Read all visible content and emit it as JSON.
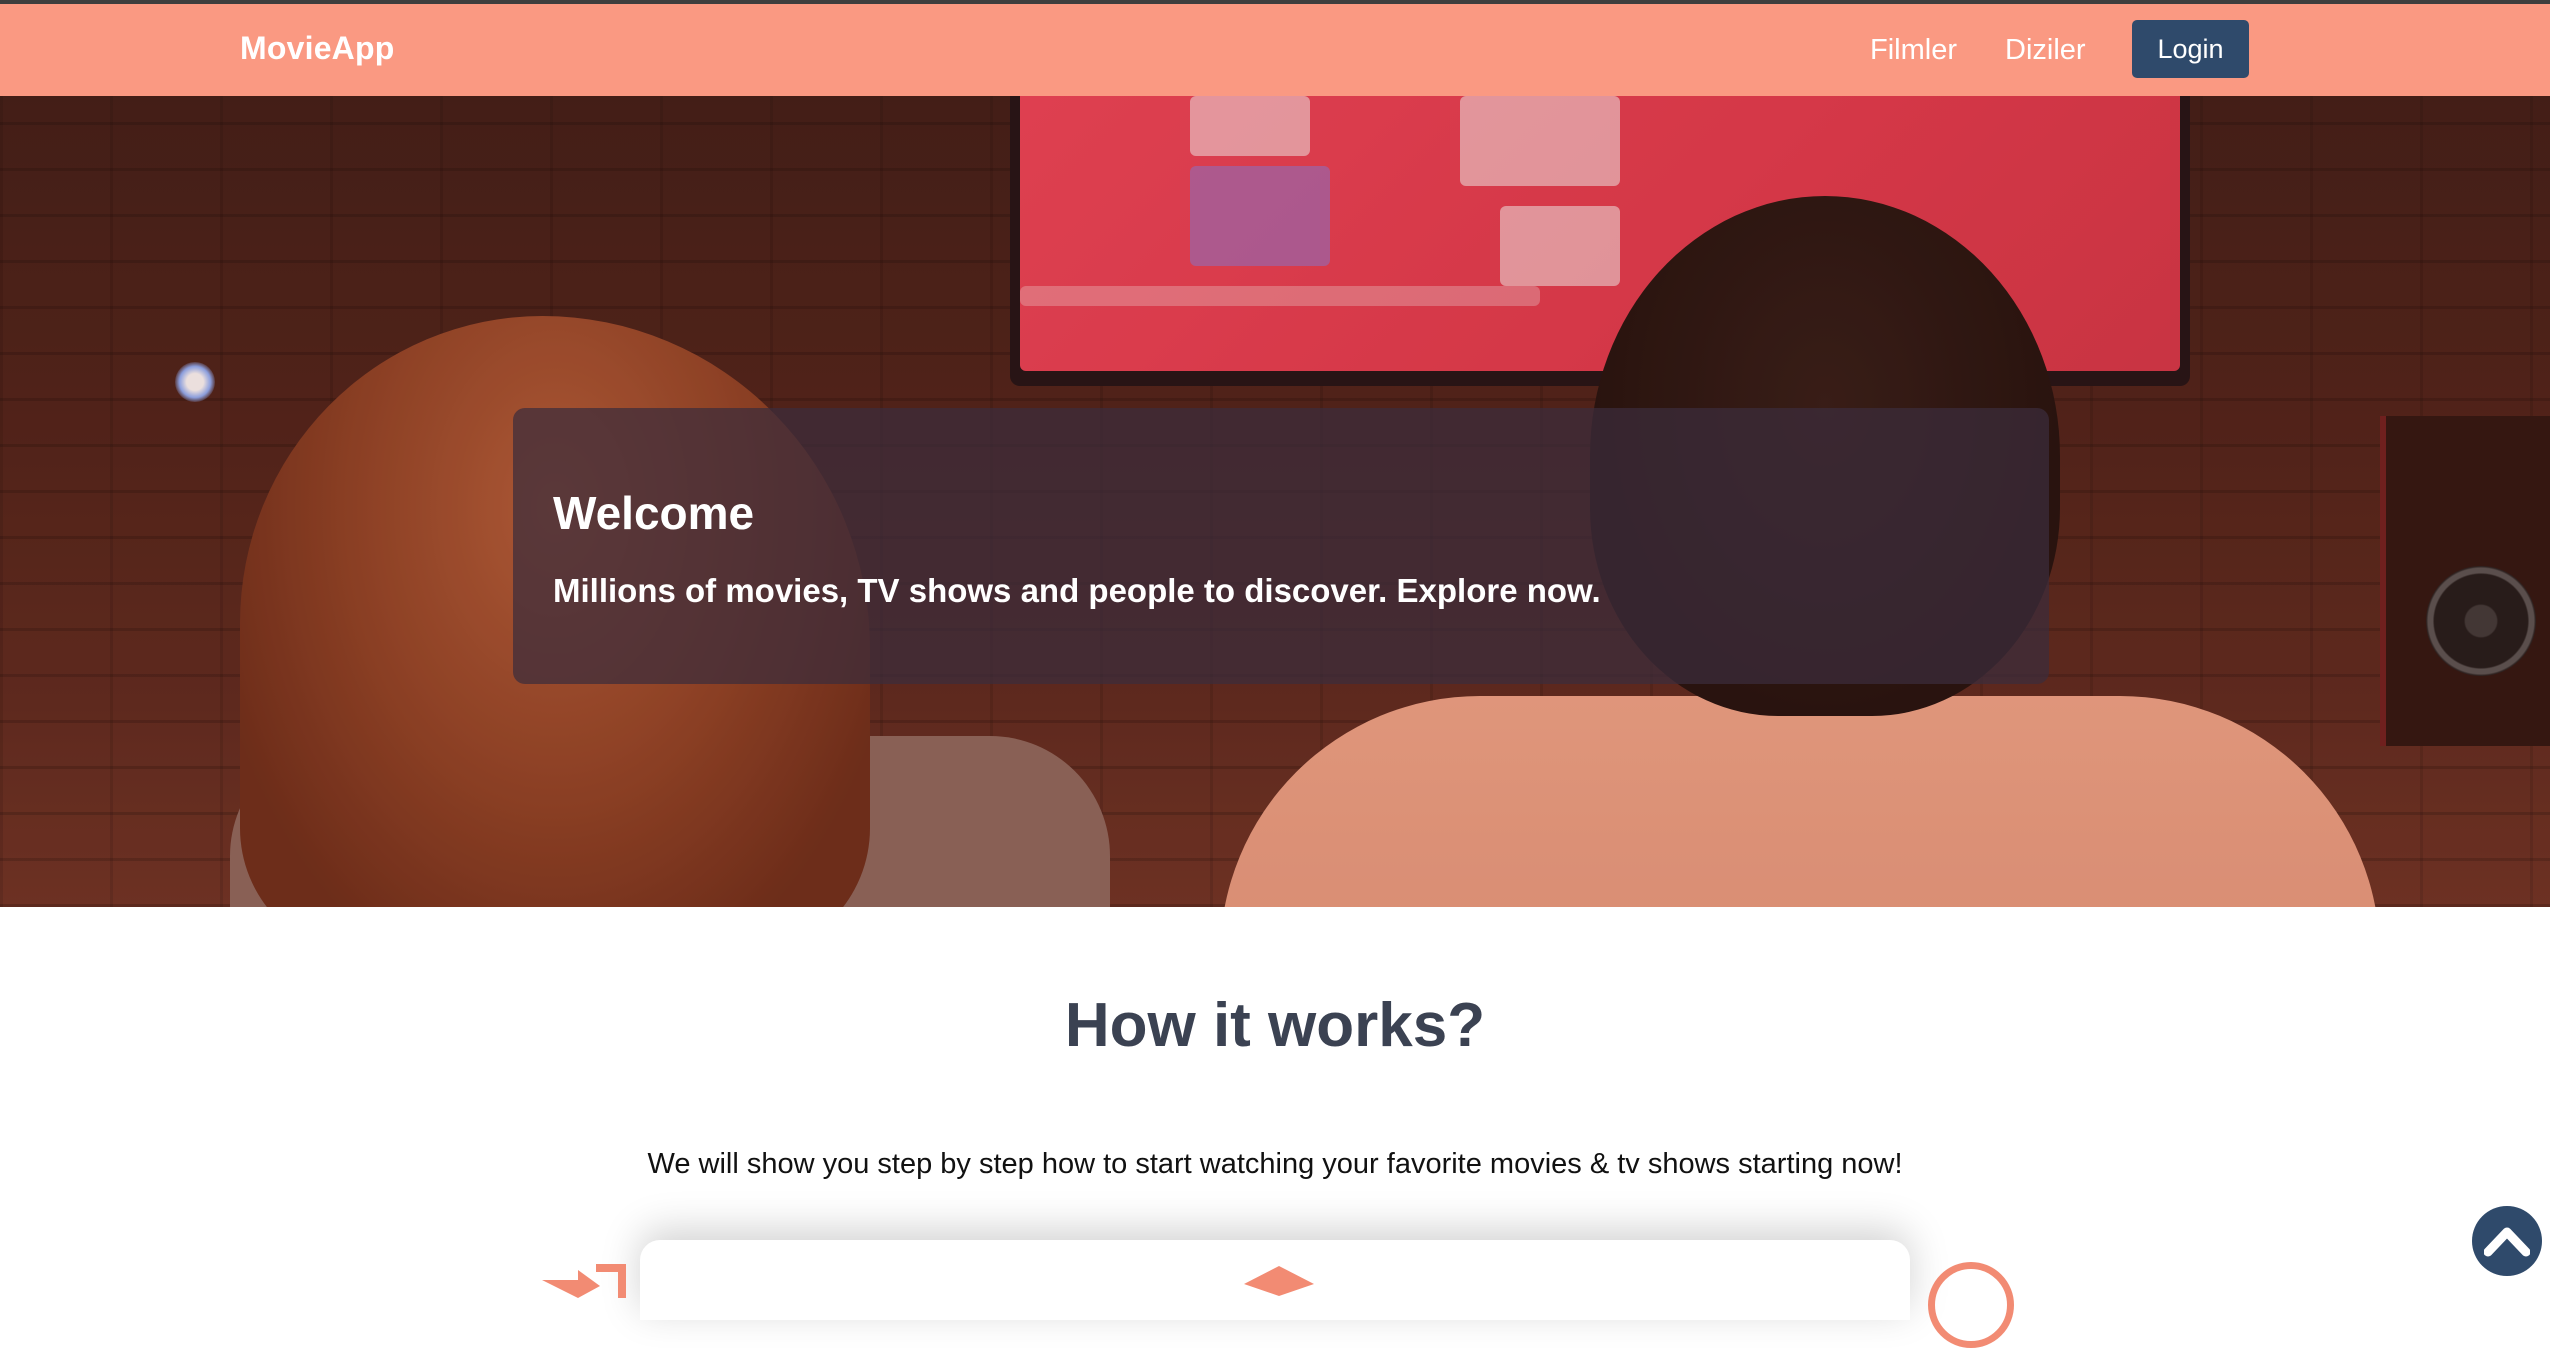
{
  "navbar": {
    "brand": "MovieApp",
    "links": [
      "Filmler",
      "Diziler"
    ],
    "login_label": "Login"
  },
  "hero": {
    "title": "Welcome",
    "subtitle": "Millions of movies, TV shows and people to discover. Explore now."
  },
  "how_it_works": {
    "title": "How it works?",
    "description": "We will show you step by step how to start watching your favorite movies & tv shows starting now!",
    "step_icons": [
      "login-arrow-icon",
      "diamond-icon",
      "circle-icon"
    ]
  },
  "scroll_top": {
    "icon": "chevron-up-icon"
  },
  "colors": {
    "navbar": "#fa9982",
    "primary_dark": "#2f4a6b",
    "heading": "#3b4252",
    "accent": "#f28b73"
  }
}
